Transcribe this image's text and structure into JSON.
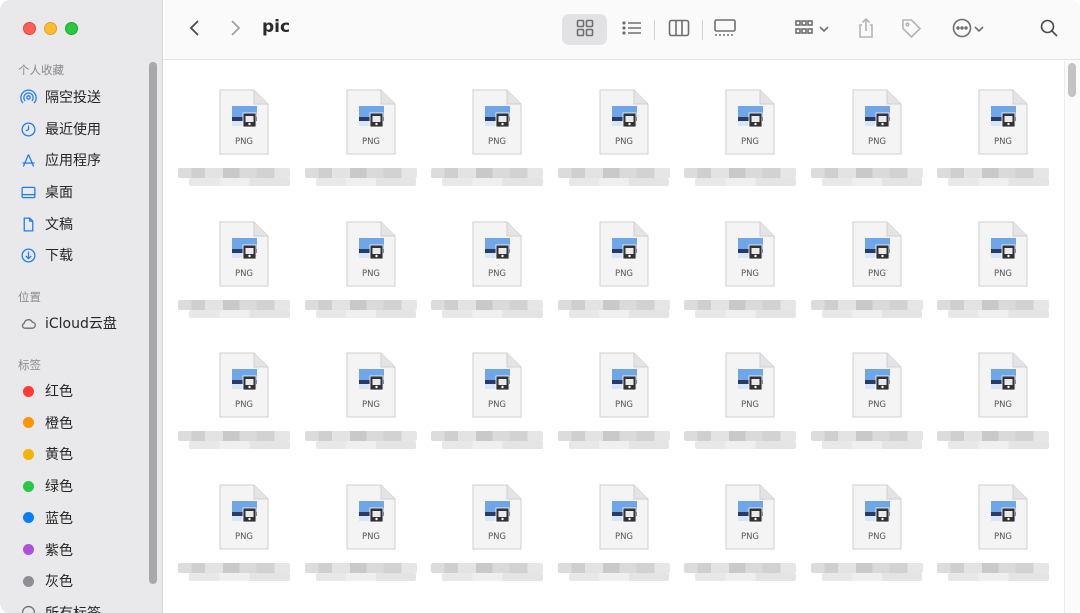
{
  "window": {
    "folder_title": "pic"
  },
  "sidebar": {
    "sections": {
      "favorites_title": "个人收藏",
      "locations_title": "位置",
      "tags_title": "标签"
    },
    "favorites": [
      {
        "label": "隔空投送",
        "icon": "airdrop-icon"
      },
      {
        "label": "最近使用",
        "icon": "clock-icon"
      },
      {
        "label": "应用程序",
        "icon": "applications-icon"
      },
      {
        "label": "桌面",
        "icon": "desktop-icon"
      },
      {
        "label": "文稿",
        "icon": "document-icon"
      },
      {
        "label": "下载",
        "icon": "download-icon"
      }
    ],
    "locations": [
      {
        "label": "iCloud云盘",
        "icon": "cloud-icon"
      }
    ],
    "tags": [
      {
        "label": "红色",
        "color": "#ff3b30"
      },
      {
        "label": "橙色",
        "color": "#ff9500"
      },
      {
        "label": "黄色",
        "color": "#f5b400"
      },
      {
        "label": "绿色",
        "color": "#28c840"
      },
      {
        "label": "蓝色",
        "color": "#0a7cff"
      },
      {
        "label": "紫色",
        "color": "#b04fd9"
      },
      {
        "label": "灰色",
        "color": "#8e8e93"
      },
      {
        "label": "所有标签",
        "color": ""
      }
    ]
  },
  "files": {
    "type_label": "PNG",
    "rows": 4,
    "columns": 7
  }
}
